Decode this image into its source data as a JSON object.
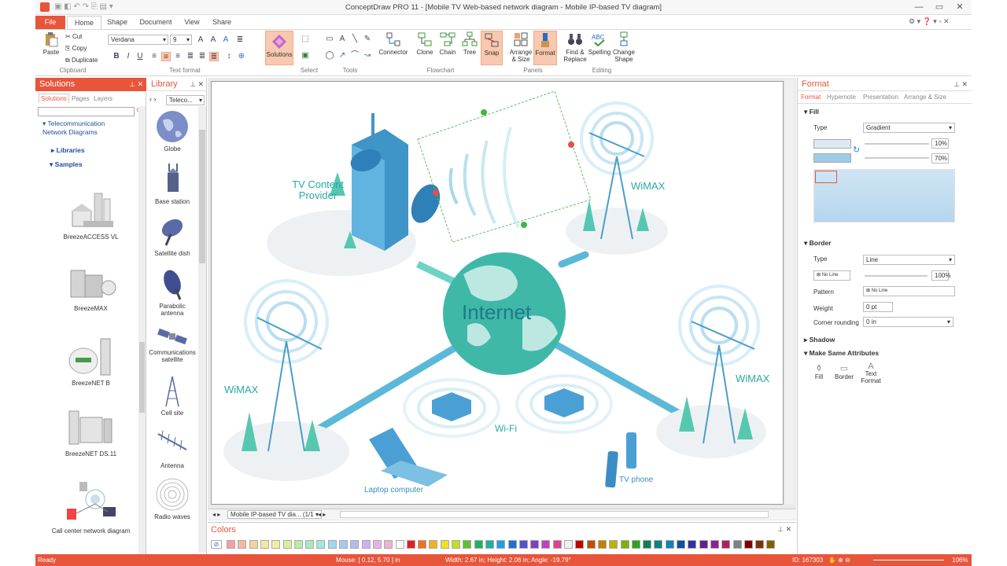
{
  "window": {
    "title": "ConceptDraw PRO 11 - [Mobile TV Web-based network diagram - Mobile IP-based TV diagram]"
  },
  "tabs": [
    "File",
    "Home",
    "Shape",
    "Document",
    "View",
    "Share"
  ],
  "ribbon": {
    "clipboard": {
      "paste": "Paste",
      "cut": "Cut",
      "copy": "Copy",
      "duplicate": "Duplicate",
      "group": "Clipboard"
    },
    "text_format": {
      "font": "Verdana",
      "size": "9",
      "group": "Text format"
    },
    "solutions": {
      "label": "Solutions"
    },
    "select": {
      "group": "Select"
    },
    "tools": {
      "group": "Tools"
    },
    "connector": {
      "label": "Connector"
    },
    "flowchart": {
      "clone": "Clone",
      "chain": "Chain",
      "tree": "Tree",
      "snap": "Snap",
      "group": "Flowchart"
    },
    "panels": {
      "arrange": "Arrange & Size",
      "format": "Format",
      "group": "Panels"
    },
    "editing": {
      "find": "Find & Replace",
      "spelling": "Spelling",
      "change": "Change Shape",
      "group": "Editing"
    }
  },
  "solutions_panel": {
    "title": "Solutions",
    "tabs": [
      "Solutions",
      "Pages",
      "Layers"
    ],
    "tree": {
      "root": "Telecommunication Network Diagrams",
      "libraries": "Libraries",
      "samples": "Samples"
    },
    "items": [
      "BreezeACCESS VL",
      "BreezeMAX",
      "BreezeNET B",
      "BreezeNET DS.11",
      "Call center network diagram"
    ]
  },
  "library_panel": {
    "title": "Library",
    "selector": "Teleco...",
    "items": [
      "Globe",
      "Base station",
      "Satellite dish",
      "Parabolic antenna",
      "Communications satellite",
      "Cell site",
      "Antenna",
      "Radio waves"
    ]
  },
  "diagram": {
    "tv_content": "TV Content Provider",
    "internet": "Internet",
    "wimax_top": "WiMAX",
    "wimax_left": "WiMAX",
    "wimax_right": "WiMAX",
    "wifi": "Wi-Fi",
    "laptop": "Laptop computer",
    "tv_phone": "TV phone"
  },
  "page_tabs": {
    "current": "Mobile IP-based TV dia...",
    "count": "(1/1"
  },
  "format_panel": {
    "title": "Format",
    "tabs": [
      "Format",
      "Hypernote",
      "Presentation",
      "Arrange & Size"
    ],
    "fill": {
      "section": "Fill",
      "type_label": "Type",
      "type_value": "Gradient",
      "pct1": "10%",
      "pct2": "70%"
    },
    "border": {
      "section": "Border",
      "type_label": "Type",
      "type_value": "Line",
      "no_line": "No Line",
      "pct": "100%",
      "pattern_label": "Pattern",
      "pattern_value": "No Line",
      "weight_label": "Weight",
      "weight_value": "0 pt",
      "corner_label": "Corner rounding",
      "corner_value": "0 in"
    },
    "shadow": "Shadow",
    "make_same": {
      "section": "Make Same Attributes",
      "fill": "Fill",
      "border": "Border",
      "text": "Text Format"
    }
  },
  "colors_panel": {
    "title": "Colors",
    "palette": [
      "#f2a0a0",
      "#f6b8a0",
      "#f7d0a0",
      "#f8e6a0",
      "#eef0a0",
      "#d8f0a0",
      "#b8eca8",
      "#a8e8c0",
      "#a0e8e0",
      "#a0d8f0",
      "#a8c8f0",
      "#b8b8f0",
      "#d0b0f0",
      "#e8b0e8",
      "#f0b0d0",
      "#ffffff",
      "#e02020",
      "#f07020",
      "#f0b020",
      "#f0e020",
      "#c0e020",
      "#60c030",
      "#20b060",
      "#20b0a0",
      "#20a0e0",
      "#2070d0",
      "#5050d0",
      "#8040c0",
      "#c040c0",
      "#e04090",
      "#f0f0f0",
      "#c00000",
      "#c05000",
      "#c08000",
      "#c0b000",
      "#80b000",
      "#30a020",
      "#108050",
      "#108080",
      "#1080c0",
      "#1050a0",
      "#3030a0",
      "#602090",
      "#902090",
      "#b02060",
      "#808080",
      "#800000",
      "#803000",
      "#806000"
    ]
  },
  "status": {
    "ready": "Ready",
    "mouse": "Mouse: [ 0.12, 5.70 ] in",
    "size": "Width: 2.67 in;  Height: 2.06 in;  Angle: -19.79°",
    "id": "ID: 167303",
    "zoom": "106%"
  }
}
